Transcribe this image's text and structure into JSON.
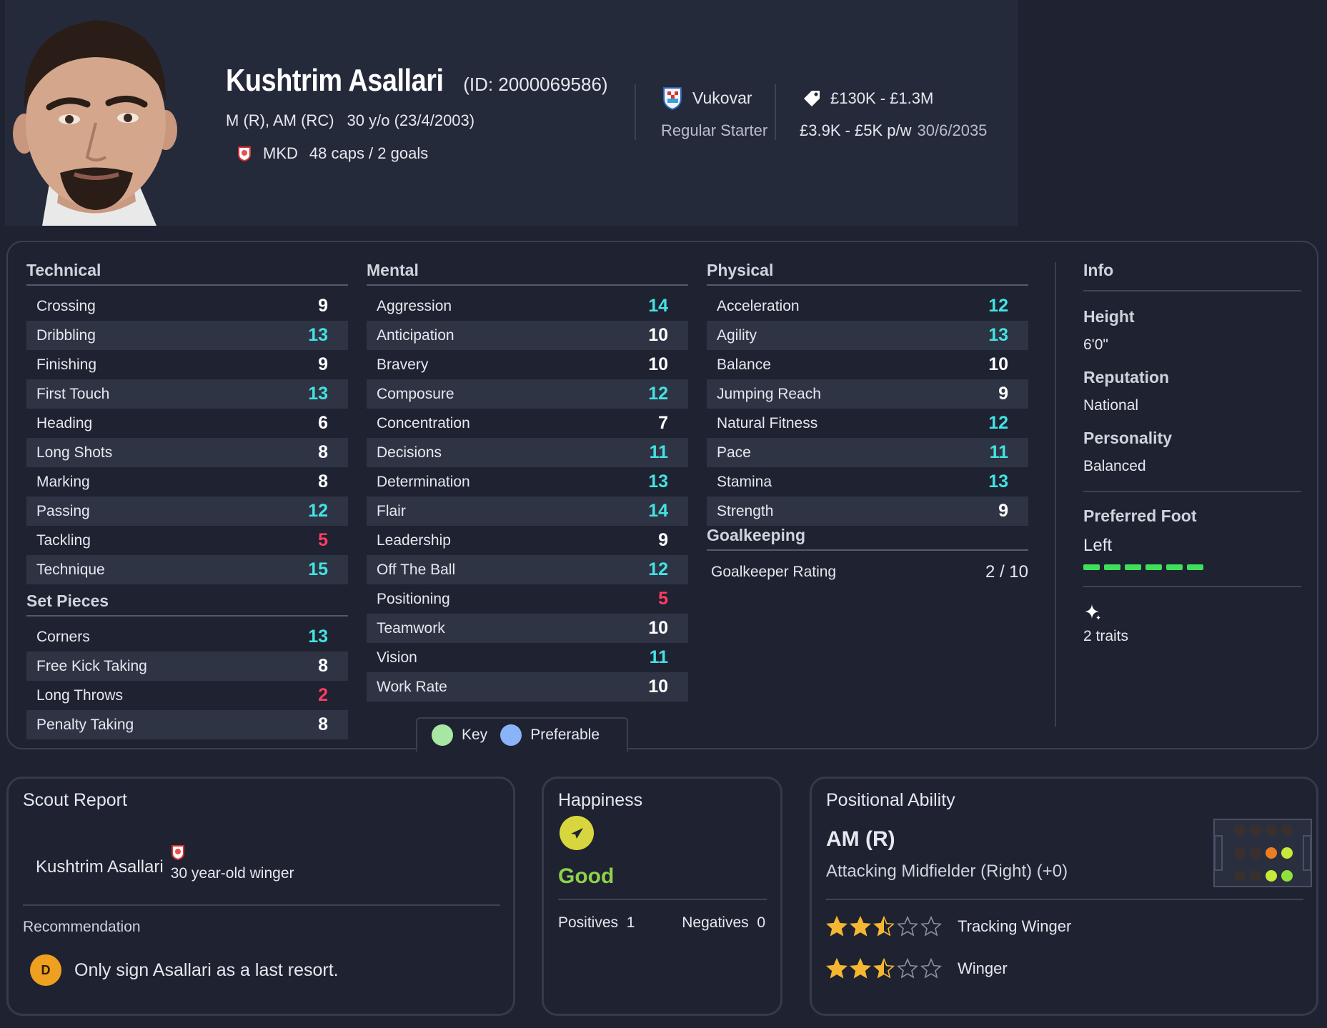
{
  "player": {
    "name": "Kushtrim Asallari",
    "id_text": "(ID: 2000069586)",
    "positions": "M (R), AM (RC)",
    "age": "30 y/o (23/4/2003)",
    "nation": "MKD",
    "caps": "48 caps / 2 goals",
    "club": "Vukovar",
    "squad_status": "Regular Starter",
    "value": "£130K - £1.3M",
    "wage": "£3.9K - £5K p/w",
    "contract_end": "30/6/2035"
  },
  "colors": {
    "high": "#43e3e3",
    "normal": "#ffffff",
    "low": "#ff3d63",
    "key": "#a8e6a3",
    "preferable": "#8ab4f8"
  },
  "technical": {
    "title": "Technical",
    "rows": [
      {
        "label": "Crossing",
        "value": "9",
        "tone": "normal"
      },
      {
        "label": "Dribbling",
        "value": "13",
        "tone": "high"
      },
      {
        "label": "Finishing",
        "value": "9",
        "tone": "normal"
      },
      {
        "label": "First Touch",
        "value": "13",
        "tone": "high"
      },
      {
        "label": "Heading",
        "value": "6",
        "tone": "normal"
      },
      {
        "label": "Long Shots",
        "value": "8",
        "tone": "normal"
      },
      {
        "label": "Marking",
        "value": "8",
        "tone": "normal"
      },
      {
        "label": "Passing",
        "value": "12",
        "tone": "high"
      },
      {
        "label": "Tackling",
        "value": "5",
        "tone": "low"
      },
      {
        "label": "Technique",
        "value": "15",
        "tone": "high"
      }
    ]
  },
  "set_pieces": {
    "title": "Set Pieces",
    "rows": [
      {
        "label": "Corners",
        "value": "13",
        "tone": "high"
      },
      {
        "label": "Free Kick Taking",
        "value": "8",
        "tone": "normal"
      },
      {
        "label": "Long Throws",
        "value": "2",
        "tone": "low"
      },
      {
        "label": "Penalty Taking",
        "value": "8",
        "tone": "normal"
      }
    ]
  },
  "mental": {
    "title": "Mental",
    "rows": [
      {
        "label": "Aggression",
        "value": "14",
        "tone": "high"
      },
      {
        "label": "Anticipation",
        "value": "10",
        "tone": "normal"
      },
      {
        "label": "Bravery",
        "value": "10",
        "tone": "normal"
      },
      {
        "label": "Composure",
        "value": "12",
        "tone": "high"
      },
      {
        "label": "Concentration",
        "value": "7",
        "tone": "normal"
      },
      {
        "label": "Decisions",
        "value": "11",
        "tone": "high"
      },
      {
        "label": "Determination",
        "value": "13",
        "tone": "high"
      },
      {
        "label": "Flair",
        "value": "14",
        "tone": "high"
      },
      {
        "label": "Leadership",
        "value": "9",
        "tone": "normal"
      },
      {
        "label": "Off The Ball",
        "value": "12",
        "tone": "high"
      },
      {
        "label": "Positioning",
        "value": "5",
        "tone": "low"
      },
      {
        "label": "Teamwork",
        "value": "10",
        "tone": "normal"
      },
      {
        "label": "Vision",
        "value": "11",
        "tone": "high"
      },
      {
        "label": "Work Rate",
        "value": "10",
        "tone": "normal"
      }
    ]
  },
  "physical": {
    "title": "Physical",
    "rows": [
      {
        "label": "Acceleration",
        "value": "12",
        "tone": "high"
      },
      {
        "label": "Agility",
        "value": "13",
        "tone": "high"
      },
      {
        "label": "Balance",
        "value": "10",
        "tone": "normal"
      },
      {
        "label": "Jumping Reach",
        "value": "9",
        "tone": "normal"
      },
      {
        "label": "Natural Fitness",
        "value": "12",
        "tone": "high"
      },
      {
        "label": "Pace",
        "value": "11",
        "tone": "high"
      },
      {
        "label": "Stamina",
        "value": "13",
        "tone": "high"
      },
      {
        "label": "Strength",
        "value": "9",
        "tone": "normal"
      }
    ]
  },
  "goalkeeping": {
    "title": "Goalkeeping",
    "label": "Goalkeeper Rating",
    "value": "2 / 10"
  },
  "info": {
    "title": "Info",
    "height_label": "Height",
    "height": "6'0\"",
    "reputation_label": "Reputation",
    "reputation": "National",
    "personality_label": "Personality",
    "personality": "Balanced",
    "foot_label": "Preferred Foot",
    "foot": "Left",
    "traits_icon": "sparkle-icon",
    "traits": "2 traits"
  },
  "legend": {
    "key": "Key",
    "preferable": "Preferable"
  },
  "scout": {
    "title": "Scout Report",
    "name": "Kushtrim Asallari",
    "description": "30 year-old winger",
    "recommendation_label": "Recommendation",
    "grade": "D",
    "recommendation": "Only sign Asallari as a last resort."
  },
  "happiness": {
    "title": "Happiness",
    "icon": "arrow-icon",
    "status": "Good",
    "positives_label": "Positives",
    "positives": "1",
    "negatives_label": "Negatives",
    "negatives": "0"
  },
  "positional": {
    "title": "Positional Ability",
    "position": "AM (R)",
    "description": "Attacking Midfielder (Right) (+0)",
    "roles": [
      {
        "name": "Tracking Winger",
        "stars": 2.5
      },
      {
        "name": "Winger",
        "stars": 2.5
      }
    ]
  }
}
